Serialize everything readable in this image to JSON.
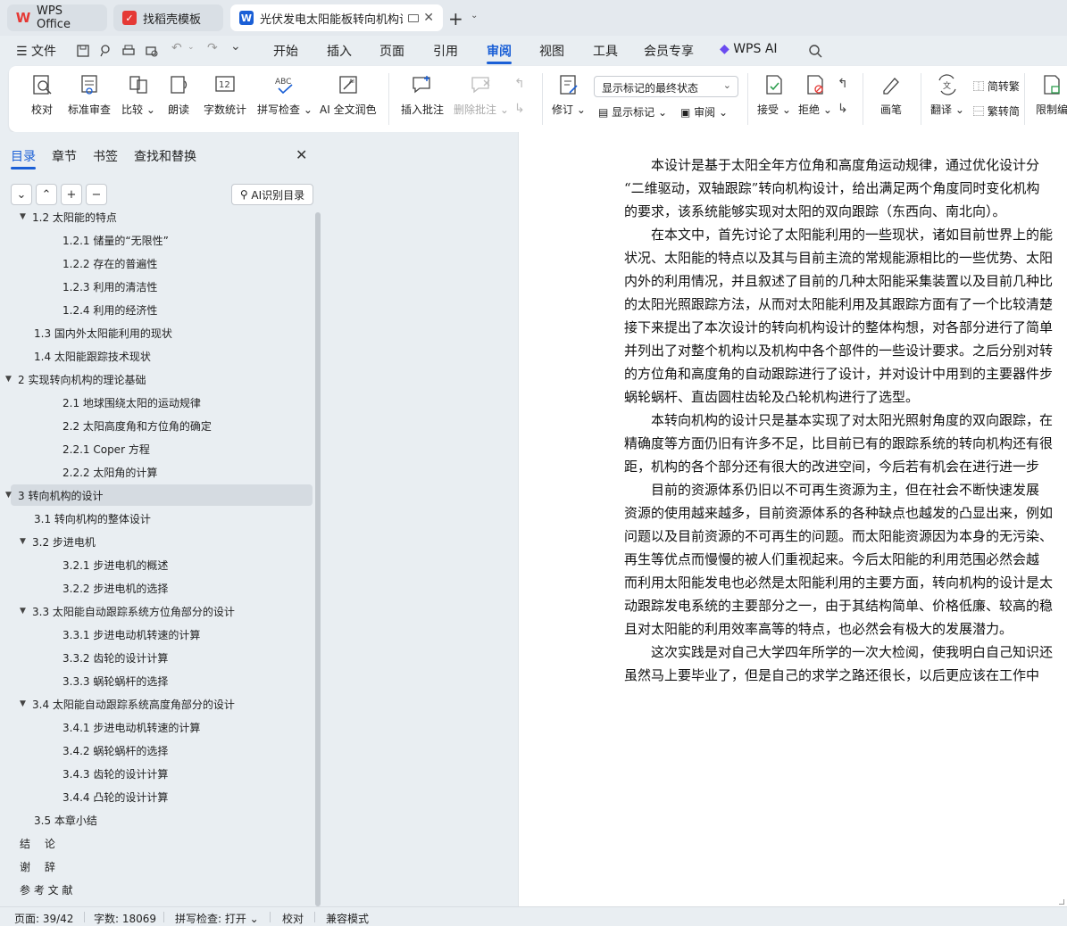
{
  "titlebar": {
    "tabs": [
      {
        "label": "WPS Office"
      },
      {
        "label": "找稻壳模板"
      },
      {
        "label": "光伏发电太阳能板转向机构设"
      }
    ]
  },
  "menu": {
    "file": "文件",
    "items": [
      "开始",
      "插入",
      "页面",
      "引用",
      "审阅",
      "视图",
      "工具",
      "会员专享",
      "WPS AI"
    ]
  },
  "ribbon": {
    "proofread": "校对",
    "standard_review": "标准审查",
    "compare": "比较",
    "read_aloud": "朗读",
    "word_count": "字数统计",
    "spell_check": "拼写检查",
    "ai_polish": "AI 全文润色",
    "insert_comment": "插入批注",
    "delete_comment": "删除批注",
    "track_changes": "修订",
    "markup_select": "显示标记的最终状态",
    "show_markup": "显示标记",
    "review_pane": "审阅",
    "accept": "接受",
    "reject": "拒绝",
    "pen": "画笔",
    "translate": "翻译",
    "to_traditional": "简转繁",
    "to_simplified": "繁转简",
    "restrict_edit": "限制编"
  },
  "leftpanel": {
    "tabs": [
      "目录",
      "章节",
      "书签",
      "查找和替换"
    ],
    "ai_button": "AI识别目录",
    "toc": [
      {
        "label": "1.2 太阳能的特点",
        "level": 2,
        "expanded": true
      },
      {
        "label": "1.2.1 储量的“无限性”",
        "level": 3
      },
      {
        "label": "1.2.2 存在的普遍性",
        "level": 3
      },
      {
        "label": "1.2.3 利用的清洁性",
        "level": 3
      },
      {
        "label": "1.2.4 利用的经济性",
        "level": 3
      },
      {
        "label": "1.3 国内外太阳能利用的现状",
        "level": 2
      },
      {
        "label": "1.4 太阳能跟踪技术现状",
        "level": 2
      },
      {
        "label": "2 实现转向机构的理论基础",
        "level": 1,
        "expanded": true
      },
      {
        "label": "2.1 地球围绕太阳的运动规律",
        "level": 3
      },
      {
        "label": "2.2 太阳高度角和方位角的确定",
        "level": 3
      },
      {
        "label": "2.2.1 Coper 方程",
        "level": 3
      },
      {
        "label": "2.2.2 太阳角的计算",
        "level": 3
      },
      {
        "label": "3 转向机构的设计",
        "level": 1,
        "expanded": true,
        "selected": true
      },
      {
        "label": "3.1 转向机构的整体设计",
        "level": 2
      },
      {
        "label": "3.2 步进电机",
        "level": 2,
        "expanded": true
      },
      {
        "label": "3.2.1 步进电机的概述",
        "level": 3
      },
      {
        "label": "3.2.2 步进电机的选择",
        "level": 3
      },
      {
        "label": "3.3 太阳能自动跟踪系统方位角部分的设计",
        "level": 2,
        "expanded": true
      },
      {
        "label": "3.3.1 步进电动机转速的计算",
        "level": 3
      },
      {
        "label": "3.3.2 齿轮的设计计算",
        "level": 3
      },
      {
        "label": "3.3.3 蜗轮蜗杆的选择",
        "level": 3
      },
      {
        "label": "3.4 太阳能自动跟踪系统高度角部分的设计",
        "level": 2,
        "expanded": true
      },
      {
        "label": "3.4.1 步进电动机转速的计算",
        "level": 3
      },
      {
        "label": "3.4.2 蜗轮蜗杆的选择",
        "level": 3
      },
      {
        "label": "3.4.3 齿轮的设计计算",
        "level": 3
      },
      {
        "label": "3.4.4 凸轮的设计计算",
        "level": 3
      },
      {
        "label": "3.5 本章小结",
        "level": 2
      },
      {
        "label": "结　 论",
        "level": 1
      },
      {
        "label": "谢　 辞",
        "level": 1
      },
      {
        "label": "参 考 文 献",
        "level": 1
      }
    ]
  },
  "document": {
    "paragraphs": [
      [
        "　　本设计是基于太阳全年方位角和高度角运动规律，通过优化设计分",
        "“二维驱动，双轴跟踪”转向机构设计，给出满足两个角度同时变化机构",
        "的要求，该系统能够实现对太阳的双向跟踪（东西向、南北向）。"
      ],
      [
        "　　在本文中，首先讨论了太阳能利用的一些现状，诸如目前世界上的能",
        "状况、太阳能的特点以及其与目前主流的常规能源相比的一些优势、太阳",
        "内外的利用情况，并且叙述了目前的几种太阳能采集装置以及目前几种比",
        "的太阳光照跟踪方法，从而对太阳能利用及其跟踪方面有了一个比较清楚",
        "接下来提出了本次设计的转向机构设计的整体构想，对各部分进行了简单",
        "并列出了对整个机构以及机构中各个部件的一些设计要求。之后分别对转",
        "的方位角和高度角的自动跟踪进行了设计，并对设计中用到的主要器件步",
        "蜗轮蜗杆、直齿圆柱齿轮及凸轮机构进行了选型。"
      ],
      [
        "　　本转向机构的设计只是基本实现了对太阳光照射角度的双向跟踪，在",
        "精确度等方面仍旧有许多不足，比目前已有的跟踪系统的转向机构还有很",
        "距，机构的各个部分还有很大的改进空间，今后若有机会在进行进一步"
      ],
      [
        "　　目前的资源体系仍旧以不可再生资源为主，但在社会不断快速发展",
        "资源的使用越来越多，目前资源体系的各种缺点也越发的凸显出来，例如",
        "问题以及目前资源的不可再生的问题。而太阳能资源因为本身的无污染、",
        "再生等优点而慢慢的被人们重视起来。今后太阳能的利用范围必然会越",
        "而利用太阳能发电也必然是太阳能利用的主要方面，转向机构的设计是太",
        "动跟踪发电系统的主要部分之一，由于其结构简单、价格低廉、较高的稳",
        "且对太阳能的利用效率高等的特点，也必然会有极大的发展潜力。"
      ],
      [
        "　　这次实践是对自己大学四年所学的一次大检阅，使我明白自己知识还",
        "虽然马上要毕业了，但是自己的求学之路还很长，以后更应该在工作中"
      ]
    ]
  },
  "status": {
    "page": "页面: 39/42",
    "words": "字数: 18069",
    "spell": "拼写检查: 打开",
    "proof": "校对",
    "compat": "兼容模式"
  },
  "colors": {
    "accent": "#1a5fd6",
    "wps_red": "#e53935"
  }
}
